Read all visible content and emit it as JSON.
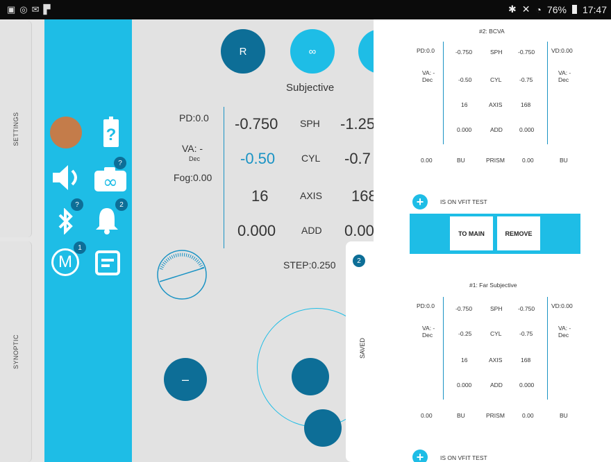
{
  "status_bar": {
    "left_icons": [
      "gallery-icon",
      "whatsapp-icon",
      "mail-icon",
      "flipboard-icon"
    ],
    "time": "17:47",
    "battery": "76%"
  },
  "edge_tabs": {
    "settings": "SETTINGS",
    "synoptic": "SYNOPTIC"
  },
  "toolbar": {
    "badges": {
      "camera": "?",
      "bluetooth": "?",
      "bell": "2",
      "m": "1"
    },
    "m_label": "M"
  },
  "main": {
    "buttons": {
      "r": "R",
      "inf": "∞"
    },
    "mode_title": "Subjective",
    "pd": "PD:0.0",
    "va": "VA: -",
    "va_unit": "Dec",
    "fog": "Fog:0.00",
    "rows": [
      {
        "left": "-0.750",
        "label": "SPH",
        "right": "-1.25"
      },
      {
        "left": "-0.50",
        "label": "CYL",
        "right": "-0.7"
      },
      {
        "left": "16",
        "label": "AXIS",
        "right": "168"
      },
      {
        "left": "0.000",
        "label": "ADD",
        "right": "0.00"
      }
    ],
    "step": "STEP:0.250",
    "minus": "–"
  },
  "panel": {
    "card2": {
      "title": "#2: BCVA",
      "pd_left": "PD:0.0",
      "vd_right": "VD:0.00",
      "va_left": "VA: -",
      "va_left_unit": "Dec",
      "va_right": "VA: -",
      "va_right_unit": "Dec",
      "rows": [
        {
          "l": "-0.750",
          "m": "SPH",
          "r": "-0.750"
        },
        {
          "l": "-0.50",
          "m": "CYL",
          "r": "-0.75"
        },
        {
          "l": "16",
          "m": "AXIS",
          "r": "168"
        },
        {
          "l": "0.000",
          "m": "ADD",
          "r": "0.000"
        }
      ],
      "prism": {
        "a": "0.00",
        "b": "BU",
        "c": "PRISM",
        "d": "0.00",
        "e": "BU"
      }
    },
    "vfit_label": "IS ON VFIT TEST",
    "to_main": "TO MAIN",
    "remove": "REMOVE",
    "saved_count": "2",
    "saved_label": "SAVED",
    "card1": {
      "title": "#1: Far Subjective",
      "pd_left": "PD:0.0",
      "vd_right": "VD:0.00",
      "va_left": "VA: -",
      "va_left_unit": "Dec",
      "va_right": "VA: -",
      "va_right_unit": "Dec",
      "rows": [
        {
          "l": "-0.750",
          "m": "SPH",
          "r": "-0.750"
        },
        {
          "l": "-0.25",
          "m": "CYL",
          "r": "-0.75"
        },
        {
          "l": "16",
          "m": "AXIS",
          "r": "168"
        },
        {
          "l": "0.000",
          "m": "ADD",
          "r": "0.000"
        }
      ],
      "prism": {
        "a": "0.00",
        "b": "BU",
        "c": "PRISM",
        "d": "0.00",
        "e": "BU"
      }
    },
    "vfit_label2": "IS ON VFIT TEST"
  },
  "colors": {
    "cyan": "#1ebde6",
    "dark_blue": "#0d6e97",
    "accent_blue": "#1a93c4",
    "orange": "#c47c4a"
  }
}
